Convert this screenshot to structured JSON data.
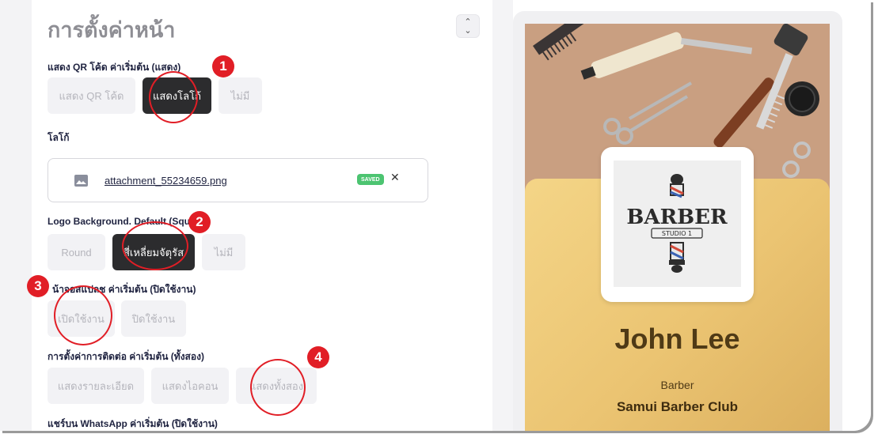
{
  "settings": {
    "title": "การตั้งค่าหน้า",
    "stepper_icon": "chevron-up-down-icon",
    "qr_section": {
      "label": "แสดง QR โค้ด ค่าเริ่มต้น (แสดง)",
      "options": [
        "แสดง QR โค้ด",
        "แสดงโลโก้",
        "ไม่มี"
      ],
      "selected": "แสดงโลโก้"
    },
    "logo_section": {
      "label": "โลโก้",
      "file_name": "attachment_55234659.png",
      "saved_badge": "SAVED",
      "remove_icon": "close-icon",
      "close_glyph": "✕"
    },
    "logo_bg_section": {
      "label": "Logo Background. Default (Squ",
      "options": [
        "Round",
        "สี่เหลี่ยมจัตุรัส",
        "ไม่มี"
      ],
      "selected": "สี่เหลี่ยมจัตุรัส"
    },
    "splash_section": {
      "label": "น้าจอสแปลช ค่าเริ่มต้น (ปิดใช้งาน)",
      "options": [
        "เปิดใช้งาน",
        "ปิดใช้งาน"
      ]
    },
    "contact_section": {
      "label": "การตั้งค่าการติดต่อ ค่าเริ่มต้น (ทั้งสอง)",
      "options": [
        "แสดงรายละเอียด",
        "แสดงไอคอน",
        "แสดงทั้งสอง"
      ]
    },
    "whatsapp_section": {
      "label": "แชร์บน WhatsApp ค่าเริ่มต้น (ปิดใช้งาน)"
    }
  },
  "preview": {
    "logo_text": "BARBER",
    "logo_subtext": "STUDIO 1",
    "name": "John Lee",
    "role": "Barber",
    "company": "Samui Barber Club"
  },
  "annotations": [
    "1",
    "2",
    "3",
    "4"
  ],
  "colors": {
    "accent": "#e11e26",
    "selected_button": "#2c2c2e",
    "card_gold": "#ebc472"
  }
}
